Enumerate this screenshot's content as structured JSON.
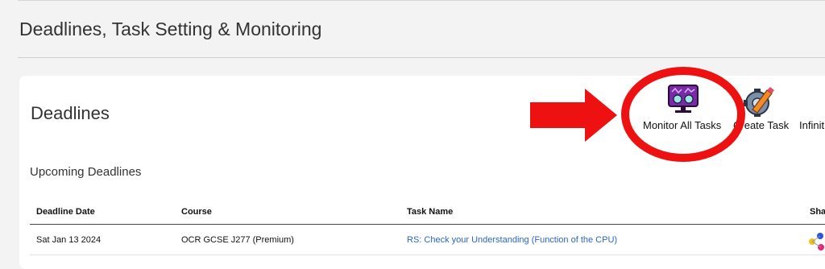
{
  "page": {
    "title": "Deadlines, Task Setting & Monitoring"
  },
  "card": {
    "title": "Deadlines",
    "subtitle": "Upcoming Deadlines",
    "tools": [
      {
        "label": "Monitor All Tasks",
        "icon": "monitor-icon"
      },
      {
        "label": "Create Task",
        "icon": "gear-pencil-icon"
      },
      {
        "label": "Infinit"
      }
    ],
    "annotation": {
      "arrow_color": "#ee1111",
      "circle_color": "#ee1111"
    }
  },
  "table": {
    "headers": [
      "Deadline Date",
      "Course",
      "Task Name",
      "Sha"
    ],
    "rows": [
      {
        "date": "Sat Jan 13 2024",
        "course": "OCR GCSE J277 (Premium)",
        "task": "RS: Check your Understanding (Function of the CPU)"
      }
    ]
  }
}
